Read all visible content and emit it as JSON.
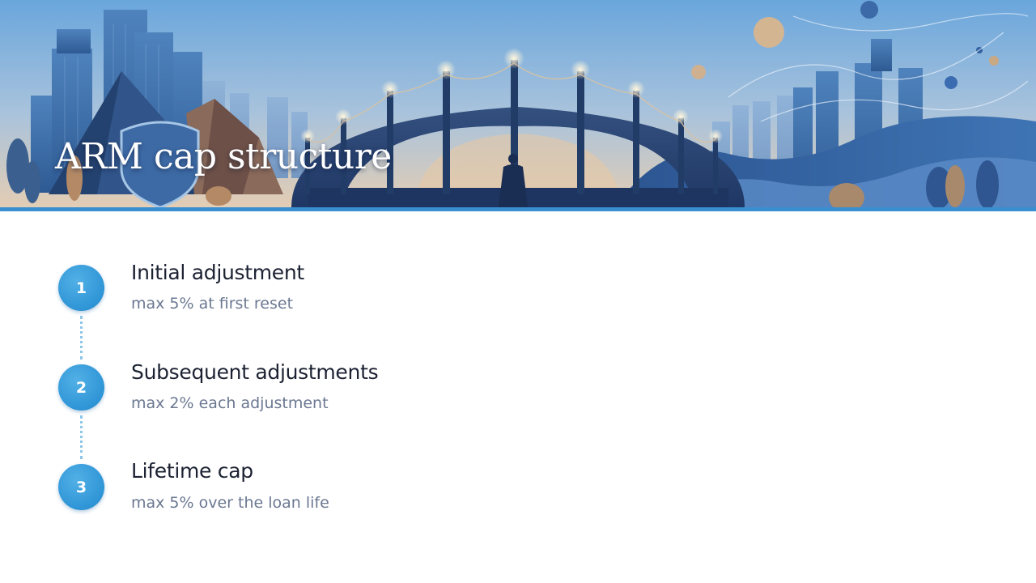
{
  "title": "ARM cap structure",
  "banner": {
    "illustration": "city-bridge-illustration",
    "accent_color": "#3a8fd0"
  },
  "steps": [
    {
      "number": "1",
      "heading": "Initial adjustment",
      "description": "max 5% at first reset"
    },
    {
      "number": "2",
      "heading": "Subsequent adjustments",
      "description": "max 2% each adjustment"
    },
    {
      "number": "3",
      "heading": "Lifetime cap",
      "description": "max 5% over the loan life"
    }
  ],
  "colors": {
    "circle": "#2f95d6",
    "connector": "#8fc6e8",
    "heading": "#1c2233",
    "description": "#6b7891"
  }
}
